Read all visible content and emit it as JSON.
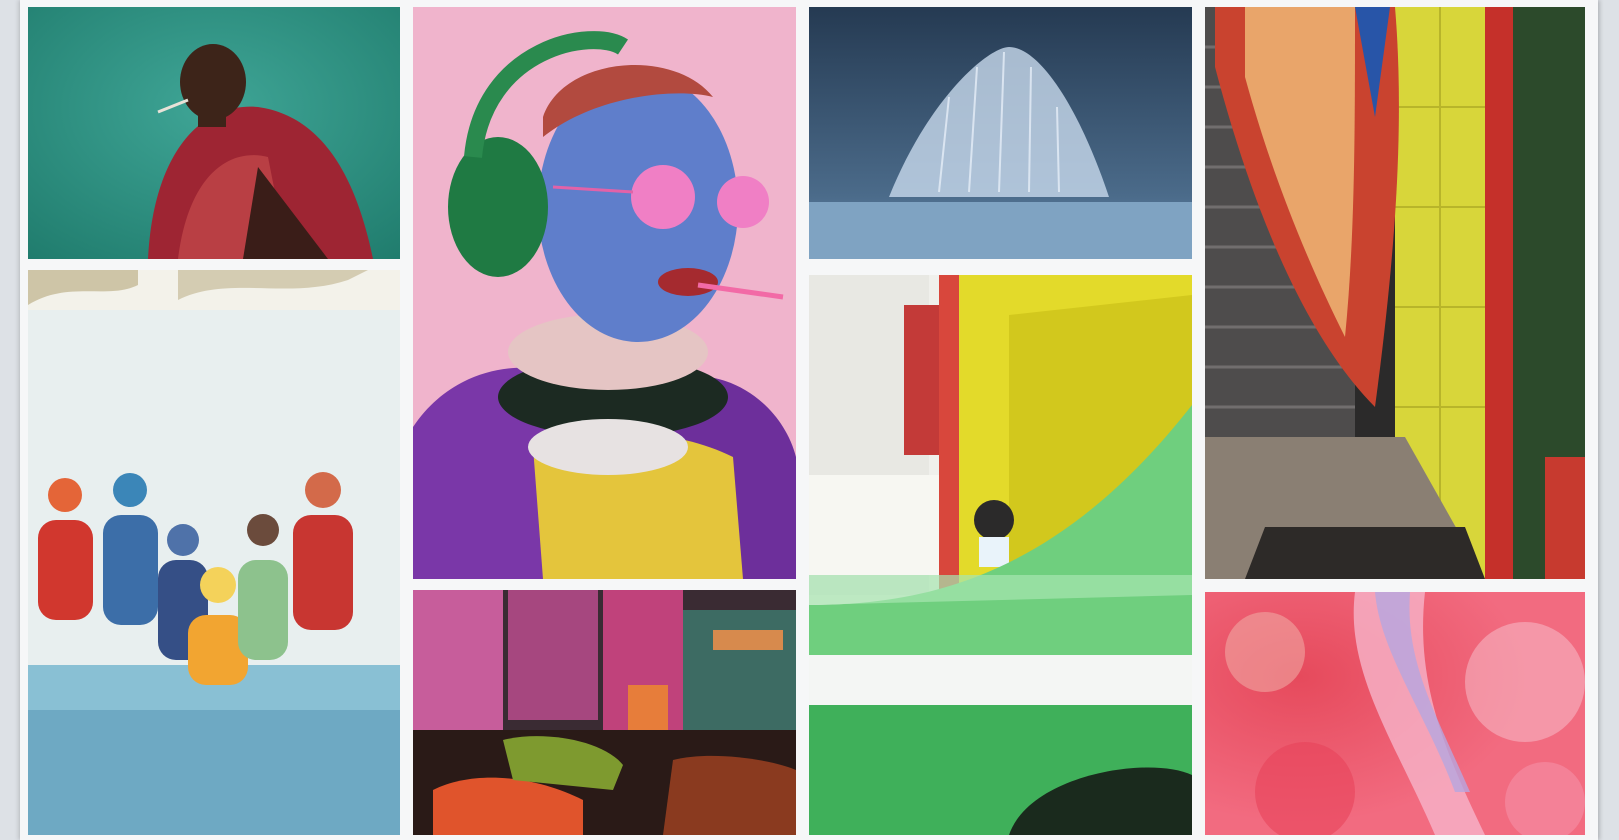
{
  "gallery": {
    "tiles": [
      {
        "id": "t1",
        "subject": "man-smoking-red-cloth-teal-wall"
      },
      {
        "id": "t2",
        "subject": "swimmers-poolside"
      },
      {
        "id": "t3",
        "subject": "blue-face-pink-glasses-portrait"
      },
      {
        "id": "t4",
        "subject": "night-market-produce-stalls"
      },
      {
        "id": "t5",
        "subject": "seascape-storm-rain"
      },
      {
        "id": "t6",
        "subject": "yellow-building-green-car"
      },
      {
        "id": "t7",
        "subject": "flag-tiled-doorway"
      },
      {
        "id": "t8",
        "subject": "pink-abstract-texture"
      }
    ]
  },
  "colors": {
    "page_bg": "#dde1e6",
    "frame_bg": "#f6f7f8"
  }
}
